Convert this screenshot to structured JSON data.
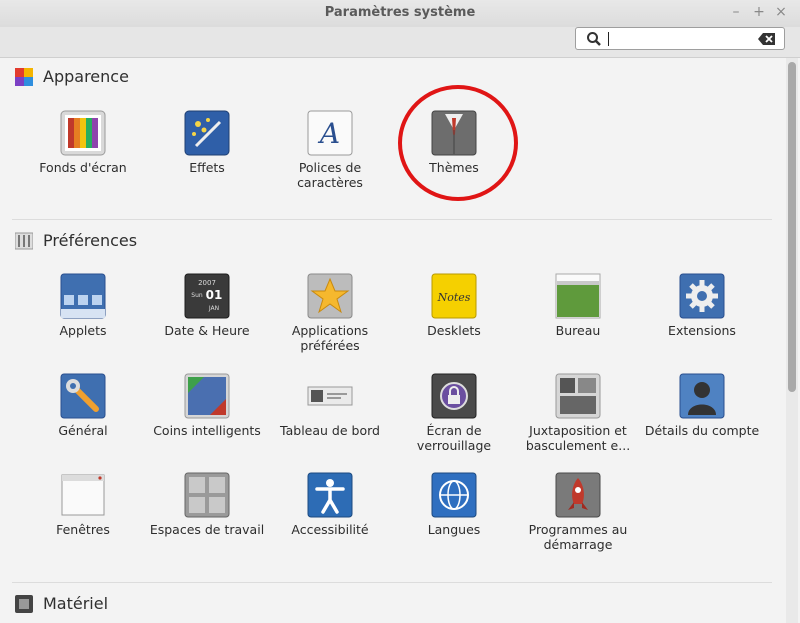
{
  "window": {
    "title": "Paramètres système"
  },
  "search": {
    "value": ""
  },
  "sections": {
    "appearance": {
      "title": "Apparence",
      "items": [
        {
          "label": "Fonds d'écran"
        },
        {
          "label": "Effets"
        },
        {
          "label": "Polices de caractères"
        },
        {
          "label": "Thèmes"
        }
      ]
    },
    "preferences": {
      "title": "Préférences",
      "items": [
        {
          "label": "Applets"
        },
        {
          "label": "Date & Heure"
        },
        {
          "label": "Applications préférées"
        },
        {
          "label": "Desklets"
        },
        {
          "label": "Bureau"
        },
        {
          "label": "Extensions"
        },
        {
          "label": "Général"
        },
        {
          "label": "Coins intelligents"
        },
        {
          "label": "Tableau de bord"
        },
        {
          "label": "Écran de verrouillage"
        },
        {
          "label": "Juxtaposition et basculement e..."
        },
        {
          "label": "Détails du compte"
        },
        {
          "label": "Fenêtres"
        },
        {
          "label": "Espaces de travail"
        },
        {
          "label": "Accessibilité"
        },
        {
          "label": "Langues"
        },
        {
          "label": "Programmes au démarrage"
        }
      ]
    },
    "hardware": {
      "title": "Matériel"
    }
  },
  "calendar_icon": {
    "year": "2007",
    "day": "Sun",
    "date": "01",
    "month": "JAN"
  },
  "desklet_icon": {
    "text": "Notes"
  },
  "colors": {
    "highlight": "#e01515",
    "accent_blue": "#3f6fb0"
  }
}
